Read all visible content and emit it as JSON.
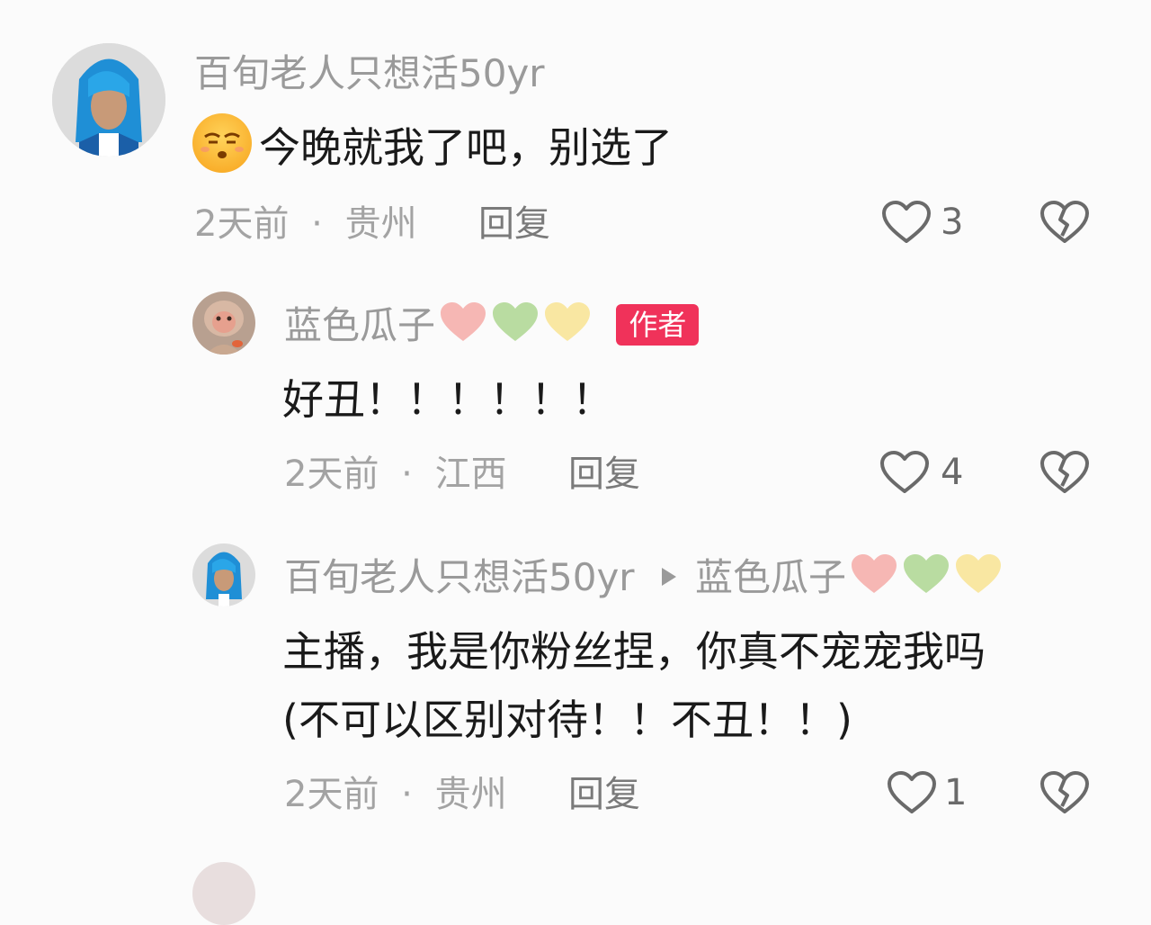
{
  "comments": [
    {
      "user": "百旬老人只想活50yr",
      "emoji": "😌",
      "text": "今晚就我了吧，别选了",
      "time": "2天前",
      "location": "贵州",
      "reply_label": "回复",
      "likes": "3"
    },
    {
      "user": "蓝色瓜子",
      "badge": "作者",
      "text": "好丑！！！！！！",
      "time": "2天前",
      "location": "江西",
      "reply_label": "回复",
      "likes": "4"
    },
    {
      "user": "百旬老人只想活50yr",
      "reply_to": "蓝色瓜子",
      "text_line1": "主播，我是你粉丝捏，你真不宠宠我吗",
      "text_line2": "(不可以区别对待！！不丑！！)",
      "time": "2天前",
      "location": "贵州",
      "reply_label": "回复",
      "likes": "1"
    }
  ],
  "separator": "·",
  "heart_colors": [
    "#f6b7b4",
    "#b9dca1",
    "#f9e7a2"
  ]
}
